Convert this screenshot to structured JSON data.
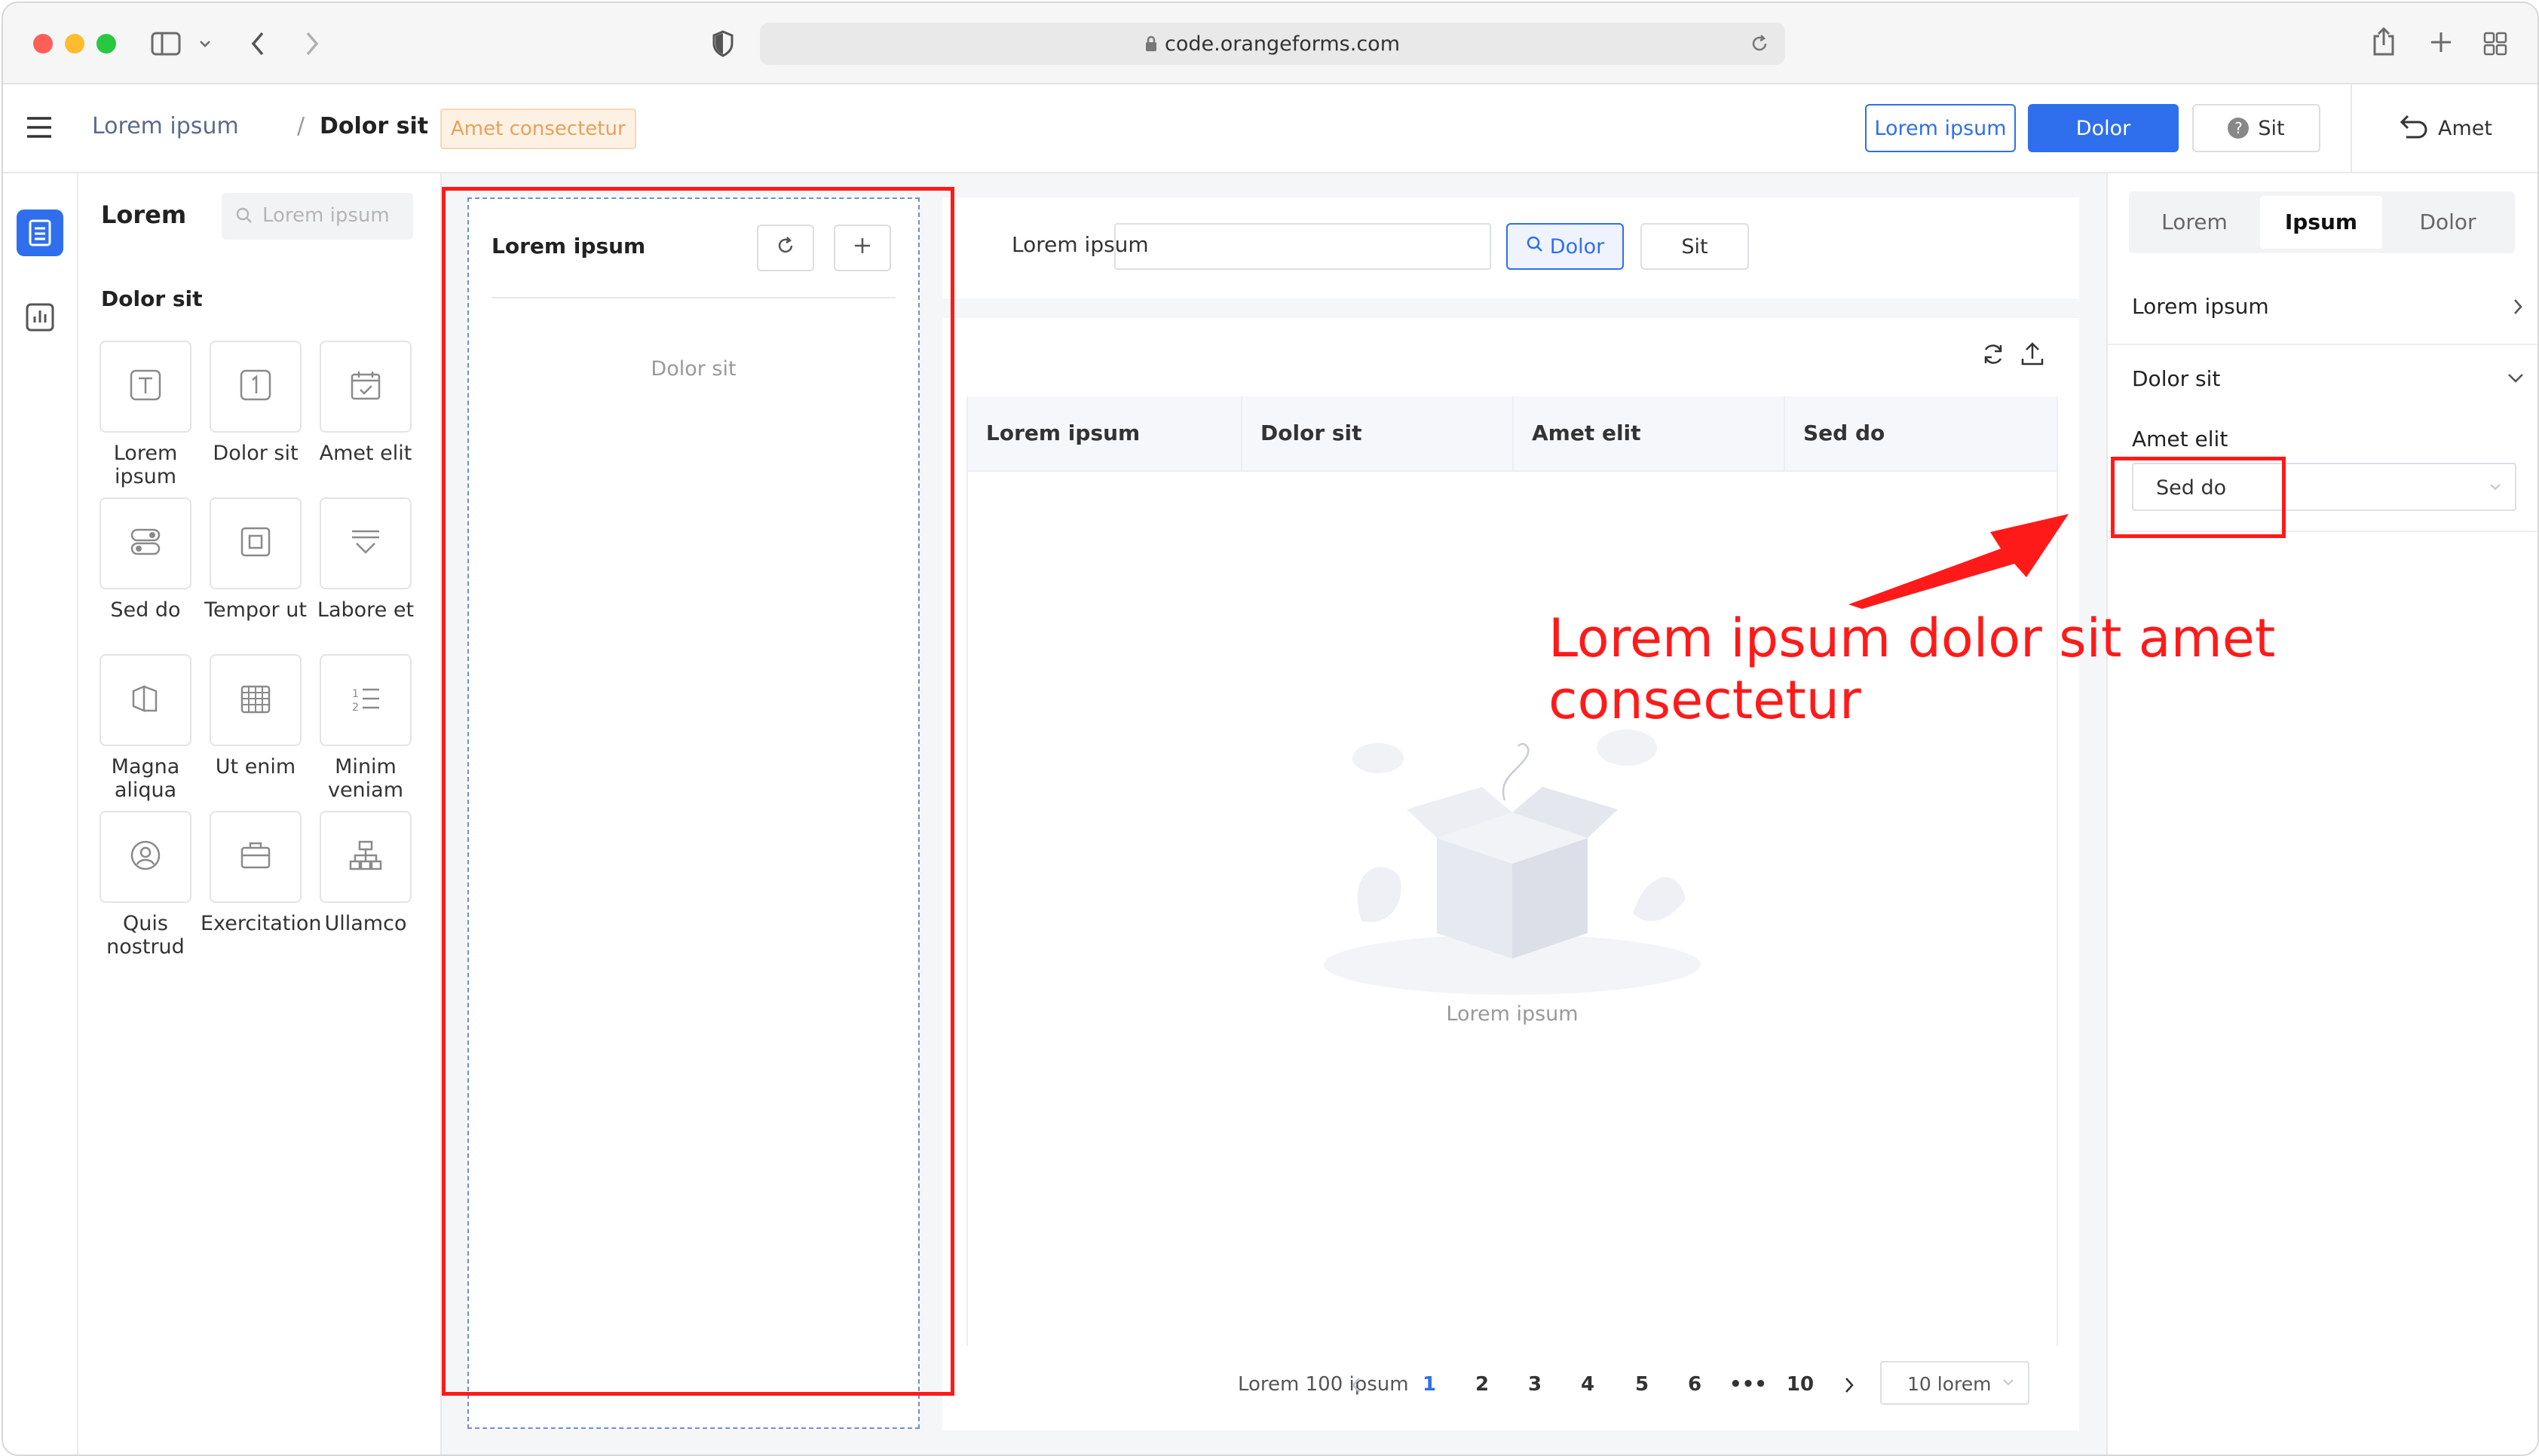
{
  "browser": {
    "url": "code.orangeforms.com",
    "traffic_colors": {
      "close": "#ff5f57",
      "minimize": "#febc2e",
      "zoom": "#28c840"
    }
  },
  "header": {
    "breadcrumb_group": "Lorem ipsum",
    "breadcrumb_sep": "/",
    "breadcrumb_current": "Dolor sit",
    "page_tag": "Amet consectetur",
    "reset_form_label": "Lorem ipsum",
    "save_label": "Dolor",
    "help_label": "Sit",
    "back_label": "Amet",
    "accent": "#2f6fed"
  },
  "components_panel": {
    "title": "Lorem",
    "search_placeholder": "Lorem ipsum",
    "section_title": "Dolor sit",
    "items": [
      {
        "label": "Lorem ipsum",
        "icon": "text-input-icon"
      },
      {
        "label": "Dolor sit",
        "icon": "number-input-icon"
      },
      {
        "label": "Amet elit",
        "icon": "calendar-icon"
      },
      {
        "label": "Sed do",
        "icon": "switch-icon"
      },
      {
        "label": "Tempor ut",
        "icon": "checkbox-icon"
      },
      {
        "label": "Labore et",
        "icon": "dropdown-icon"
      },
      {
        "label": "Magna aliqua",
        "icon": "cascade-icon"
      },
      {
        "label": "Ut enim",
        "icon": "date-range-icon"
      },
      {
        "label": "Minim veniam",
        "icon": "number-range-icon"
      },
      {
        "label": "Quis nostrud",
        "icon": "user-icon"
      },
      {
        "label": "Exercitation",
        "icon": "briefcase-icon"
      },
      {
        "label": "Ullamco",
        "icon": "hierarchy-icon"
      }
    ]
  },
  "tree": {
    "title": "Lorem ipsum",
    "empty_text": "Dolor sit"
  },
  "filter": {
    "label": "Lorem ipsum",
    "query_label": "Dolor",
    "reset_label": "Sit"
  },
  "table": {
    "columns": [
      "Lorem ipsum",
      "Dolor sit",
      "Amet elit",
      "Sed do"
    ],
    "empty_text": "Lorem ipsum"
  },
  "pagination": {
    "total_text": "Lorem 100 ipsum",
    "pages": [
      "1",
      "2",
      "3",
      "4",
      "5",
      "6",
      "•••",
      "10"
    ],
    "current_page": "1",
    "page_size": "10 lorem"
  },
  "right_panel": {
    "tabs": [
      "Lorem",
      "Ipsum",
      "Dolor"
    ],
    "active_tab": "Ipsum",
    "basic_info_label": "Lorem ipsum",
    "dict_section_label": "Dolor sit",
    "dict_select_label": "Amet elit",
    "dict_select_value": "Sed do"
  },
  "annotation": {
    "text": "Lorem ipsum dolor sit amet consectetur",
    "color": "#ff1a1a"
  }
}
